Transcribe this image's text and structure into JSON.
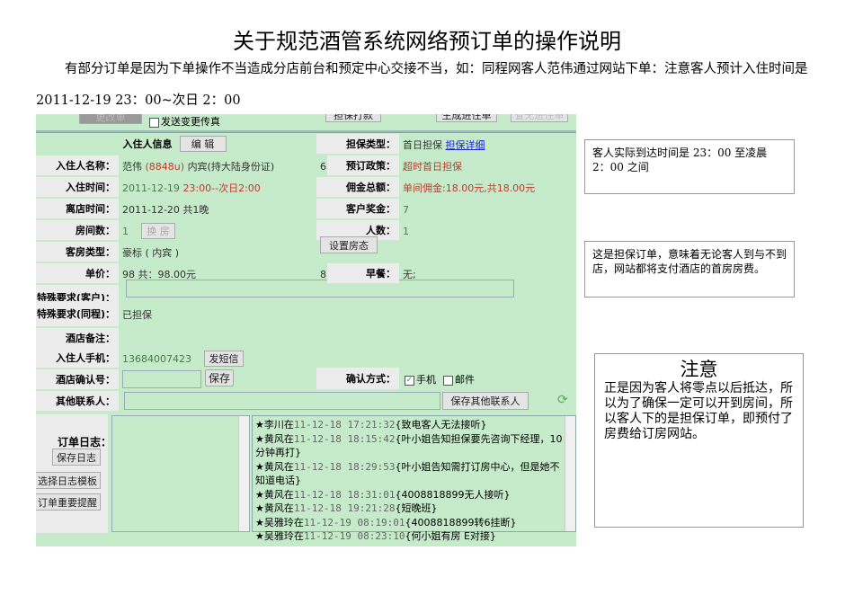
{
  "doc": {
    "title": "关于规范酒管系统网络预订单的操作说明",
    "para": "有部分订单是因为下单操作不当造成分店前台和预定中心交接不当，如：同程网客人范伟通过网站下单：注意客人预计入住时间是 2011-12-19 23：00~次日 2：00"
  },
  "toolbar": {
    "change": "更改单",
    "fax": "发送变更传真",
    "pay": "担保打款",
    "gen": "生成进住单",
    "view": "查无进住单"
  },
  "form": {
    "guest_info": "入住人信息",
    "edit": "编 辑",
    "name_l": "入住人名称：",
    "name_v": "范伟",
    "name_code": "(8848u)",
    "name_id": "内宾(持大陆身份证)",
    "in_l": "入住时间：",
    "in_date": "2011-12-19",
    "in_time": "23:00--次日2:00",
    "out_l": "离店时间：",
    "out_v": "2011-12-20   共1晚",
    "rooms_l": "房间数：",
    "rooms_v": "1",
    "swap": "换 房",
    "type_l": "客房类型：",
    "type_v": "豪标 ( 内宾 )",
    "price_l": "单价：",
    "price_v": "98    共：98.00元",
    "req_c_l": "特殊要求(客户)：",
    "req_t_l": "特殊要求(同程)：",
    "req_t_v": "已担保",
    "note_l": "酒店备注：",
    "phone_l": "入住人手机：",
    "phone_v": "13684007423",
    "sms": "发短信",
    "confirm_l": "酒店确认号：",
    "save": "保存",
    "other_l": "其他联系人：",
    "save_other": "保存其他联系人",
    "log_l": "订单日志：",
    "save_log": "保存日志",
    "tpl": "选择日志模板",
    "remind": "订单重要提醒",
    "g_type_l": "担保类型：",
    "g_type_v": "首日担保",
    "g_detail": "担保详细",
    "n6": "6",
    "policy_l": "预订政策：",
    "policy_v": "超时首日担保",
    "comm_l": "佣金总额：",
    "comm_v": "单间佣金:18.00元,共18.00元",
    "bonus_l": "客户奖金：",
    "bonus_v": "7",
    "people_l": "人数：",
    "people_v": "1",
    "set_room": "设置房态",
    "n8": "8",
    "bf_l": "早餐：",
    "bf_v": "无;",
    "cm_l": "确认方式：",
    "cm_phone": "手机",
    "cm_mail": "邮件"
  },
  "log": [
    {
      "who": "★李川在",
      "t": "11-12-18 17:21:32",
      "m": "{致电客人无法接听}"
    },
    {
      "who": "★黄风在",
      "t": "11-12-18 18:15:42",
      "m": "{叶小姐告知担保要先咨询下经理，10分钟再打}"
    },
    {
      "who": "★黄风在",
      "t": "11-12-18 18:29:53",
      "m": "{叶小姐告知需打订房中心，但是她不知道电话}"
    },
    {
      "who": "★黄风在",
      "t": "11-12-18 18:31:01",
      "m": "{4008818899无人接听}"
    },
    {
      "who": "★黄风在",
      "t": "11-12-18 19:21:28",
      "m": "{短晚班}"
    },
    {
      "who": "★吴雅玲在",
      "t": "11-12-19 08:19:01",
      "m": "{4008818899转6挂断}"
    },
    {
      "who": "★吴雅玲在",
      "t": "11-12-19 08:23:10",
      "m": "{何小姐有房 E对接}"
    }
  ],
  "callouts": {
    "c1": "客人实际到达时间是 23：00 至凌晨 2：00 之间",
    "c2": "这是担保订单，意味着无论客人到与不到店，网站都将支付酒店的首房房费。",
    "c3_title": "注意",
    "c3": "正是因为客人将零点以后抵达，所以为了确保一定可以开到房间，所以客人下的是担保订单，即预付了房费给订房网站。"
  }
}
